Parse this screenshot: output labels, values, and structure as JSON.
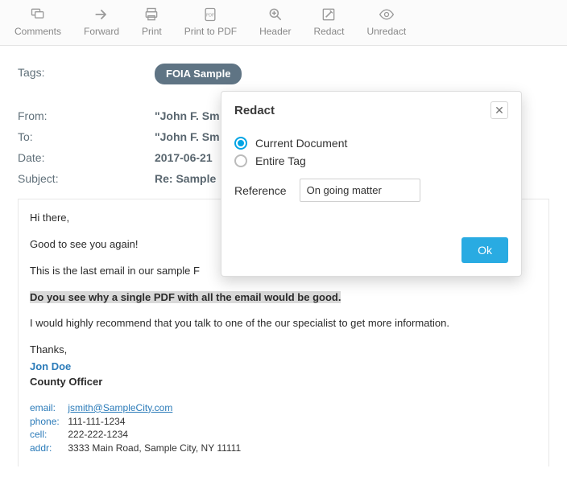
{
  "toolbar": {
    "items": [
      {
        "label": "Comments",
        "icon": "comments"
      },
      {
        "label": "Forward",
        "icon": "forward"
      },
      {
        "label": "Print",
        "icon": "print"
      },
      {
        "label": "Print to PDF",
        "icon": "print-pdf"
      },
      {
        "label": "Header",
        "icon": "header"
      },
      {
        "label": "Redact",
        "icon": "redact"
      },
      {
        "label": "Unredact",
        "icon": "unredact"
      }
    ]
  },
  "meta": {
    "tags_label": "Tags:",
    "tag": "FOIA Sample",
    "from_label": "From:",
    "from_value": "\"John F. Sm",
    "to_label": "To:",
    "to_value": "\"John F. Sm",
    "date_label": "Date:",
    "date_value": "2017-06-21",
    "subject_label": "Subject:",
    "subject_value": "Re: Sample"
  },
  "body": {
    "p1": "Hi there,",
    "p2": "Good to see you again!",
    "p3_prefix": "This is the last email in our sample F",
    "p4": "Do you see why a single PDF with all the email would be good.",
    "p5": "I would highly recommend that you talk to one of the our specialist to get more information.",
    "p6": "Thanks,",
    "sig_name": "Jon Doe",
    "sig_title": "County Officer",
    "contacts": {
      "email_k": "email:",
      "email_v": "jsmith@SampleCity.com",
      "phone_k": "phone:",
      "phone_v": "111-111-1234",
      "cell_k": "cell:",
      "cell_v": "222-222-1234",
      "addr_k": "addr:",
      "addr_v": "3333 Main Road, Sample City, NY 11111"
    }
  },
  "dialog": {
    "title": "Redact",
    "close": "✕",
    "opt1": "Current Document",
    "opt2": "Entire Tag",
    "ref_label": "Reference",
    "ref_value": "On going matter",
    "ok": "Ok"
  }
}
